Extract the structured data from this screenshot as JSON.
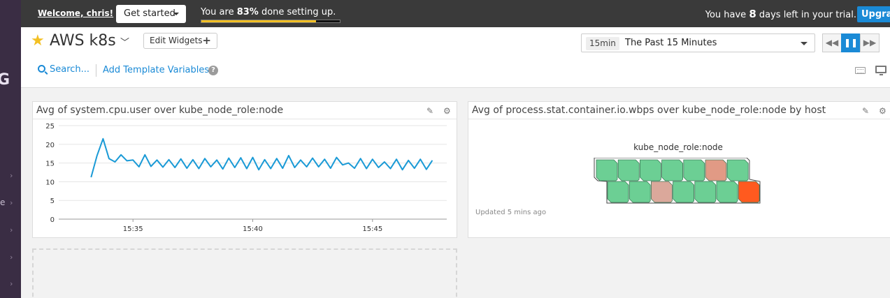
{
  "sidebar": {
    "logo_fragment": "G",
    "item_fragment": "e"
  },
  "banner": {
    "welcome": "Welcome, chris!",
    "get_started": "Get started",
    "setup_prefix": "You are ",
    "setup_percent": "83%",
    "setup_suffix": " done setting up.",
    "setup_progress": 0.83,
    "trial_prefix": "You have ",
    "trial_days": "8",
    "trial_suffix": " days left in your trial.",
    "upgrade": "Upgrade"
  },
  "header": {
    "dashboard_title": "AWS k8s",
    "edit_widgets": "Edit Widgets",
    "time_badge": "15min",
    "time_label": "The Past 15 Minutes",
    "search_link": "Search...",
    "template_link": "Add Template Variables"
  },
  "widgets": [
    {
      "title": "Avg of system.cpu.user over kube_node_role:node"
    },
    {
      "title": "Avg of process.stat.container.io.wbps over kube_node_role:node by host",
      "heatmap_title": "kube_node_role:node",
      "updated": "Updated 5 mins ago"
    }
  ],
  "colors": {
    "line": "#1a9ad6",
    "green": "#6ccf94",
    "salmon": "#e19a85",
    "pink": "#dba89b",
    "orange": "#ff5a1f",
    "accent": "#1a8ad6",
    "progress": "#f3c023"
  },
  "chart_data": [
    {
      "type": "line",
      "title": "Avg of system.cpu.user over kube_node_role:node",
      "ylim": [
        0,
        25
      ],
      "yticks": [
        "0",
        "5",
        "10",
        "15",
        "20",
        "25"
      ],
      "xticks": [
        "15:35",
        "15:40",
        "15:45"
      ],
      "xtick_minutes": [
        35,
        40,
        45
      ],
      "xlim_minutes": [
        31.9,
        48.1
      ],
      "series": [
        {
          "x_minutes": [
            33.25,
            33.5,
            33.75,
            34.0,
            34.25,
            34.5,
            34.75,
            35.0,
            35.25,
            35.5,
            35.75,
            36.0,
            36.25,
            36.5,
            36.75,
            37.0,
            37.25,
            37.5,
            37.75,
            38.0,
            38.25,
            38.5,
            38.75,
            39.0,
            39.25,
            39.5,
            39.75,
            40.0,
            40.25,
            40.5,
            40.75,
            41.0,
            41.25,
            41.5,
            41.75,
            42.0,
            42.25,
            42.5,
            42.75,
            43.0,
            43.25,
            43.5,
            43.75,
            44.0,
            44.25,
            44.5,
            44.75,
            45.0,
            45.25,
            45.5,
            45.75,
            46.0,
            46.25,
            46.5,
            46.75,
            47.0,
            47.25,
            47.5
          ],
          "values": [
            11.2,
            17.0,
            21.5,
            16.2,
            15.3,
            17.2,
            15.6,
            15.8,
            14.0,
            17.2,
            14.1,
            15.8,
            13.9,
            15.9,
            13.8,
            16.1,
            13.6,
            15.9,
            13.5,
            16.2,
            14.0,
            15.8,
            13.4,
            16.3,
            13.8,
            16.4,
            13.5,
            16.5,
            13.2,
            15.9,
            13.5,
            16.2,
            13.6,
            17.0,
            13.8,
            15.8,
            14.0,
            16.3,
            14.0,
            16.0,
            13.6,
            16.5,
            14.5,
            15.0,
            13.6,
            16.2,
            13.5,
            16.0,
            13.8,
            15.3,
            13.5,
            16.0,
            13.2,
            15.7,
            13.6,
            16.0,
            13.3,
            15.7
          ]
        }
      ]
    },
    {
      "type": "heatmap",
      "title": "Avg of process.stat.container.io.wbps over kube_node_role:node by host",
      "group": "kube_node_role:node",
      "rows": [
        [
          "green",
          "green",
          "green",
          "green",
          "green",
          "salmon",
          "green"
        ],
        [
          "green",
          "green",
          "pink",
          "green",
          "green",
          "green",
          "orange"
        ]
      ]
    }
  ]
}
